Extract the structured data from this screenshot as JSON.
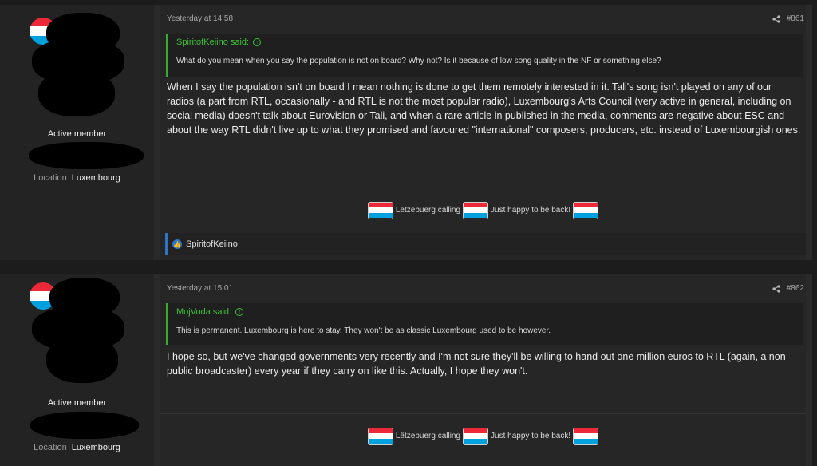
{
  "posts": [
    {
      "user": {
        "role": "Active member",
        "location_label": "Location",
        "location_value": "Luxembourg"
      },
      "timestamp": "Yesterday at 14:58",
      "post_number": "#861",
      "quote": {
        "author": "SpiritofKeiino said:",
        "text": "What do you mean when you say the population is not on board? Why not? Is it because of low song quality in the NF or something else?"
      },
      "body": "When I say the population isn't on board I mean nothing is done to get them remotely interested in it. Tali's song isn't played on any of our radios (a part from RTL, occasionally - and RTL is not the most popular radio), Luxembourg's Arts Council (very active in general, including on social media) doesn't talk about Eurovision or Tali, and when a rare article in published in the media, comments are negative about ESC and about the way RTL didn't live up to what they promised and favoured \"international\" composers, producers, etc. instead of Luxembourgish ones.",
      "signature": {
        "part1": "Lëtzebuerg calling",
        "part2": "Just happy to be back!"
      },
      "reactions": {
        "users": "SpiritofKeiino"
      }
    },
    {
      "user": {
        "role": "Active member",
        "location_label": "Location",
        "location_value": "Luxembourg"
      },
      "timestamp": "Yesterday at 15:01",
      "post_number": "#862",
      "quote": {
        "author": "MojVoda said:",
        "text": "This is permanent. Luxembourg is here to stay. They won't be as classic Luxembourg used to be however."
      },
      "body": "I hope so, but we've changed governments very recently and I'm not sure they'll be willing to hand out one million euros to RTL (again, a non-public broadcaster) every year if they carry on like this. Actually, I hope they won't.",
      "signature": {
        "part1": "Lëtzebuerg calling",
        "part2": "Just happy to be back!"
      }
    }
  ],
  "colors": {
    "quote_accent": "#3aaa35",
    "reaction_accent": "#2e74c9",
    "flag_red": "#ed2939",
    "flag_blue": "#00a1de"
  },
  "icons": {
    "share": "share-icon",
    "quote_jump": "arrow-up-circle-icon",
    "like": "like-icon"
  }
}
